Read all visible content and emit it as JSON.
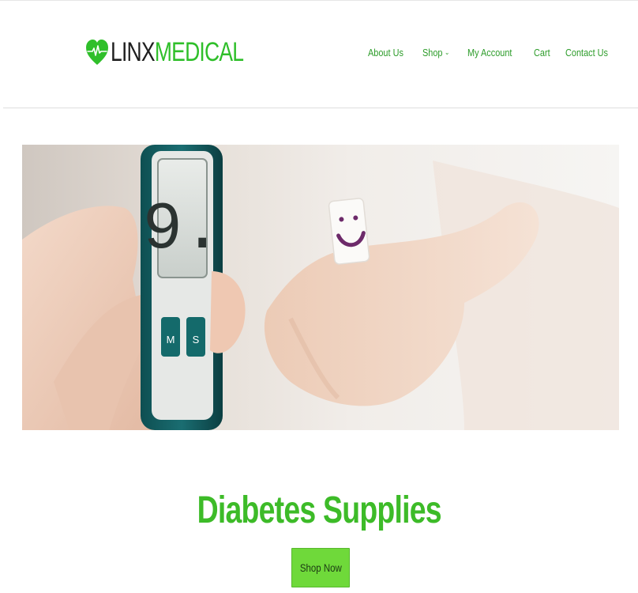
{
  "header": {
    "logo": {
      "part1": "LINX",
      "part2": "MEDICAL",
      "icon": "heart-pulse-icon"
    },
    "nav": [
      {
        "label": "About Us"
      },
      {
        "label": "Shop",
        "has_dropdown": true,
        "chevron": "⌄"
      },
      {
        "label": "My Account"
      },
      {
        "label": "Cart"
      },
      {
        "label": "Contact Us"
      }
    ]
  },
  "hero": {
    "image": "glucose-meter-and-sugar-cube-photo",
    "meter_buttons": [
      "M",
      "S"
    ]
  },
  "main": {
    "title": "Diabetes Supplies",
    "cta_label": "Shop Now"
  },
  "colors": {
    "brand_green": "#2fbf2a",
    "title_green": "#3dbb28",
    "nav_green": "#2d9c2a",
    "button_green": "#6fd93a"
  }
}
